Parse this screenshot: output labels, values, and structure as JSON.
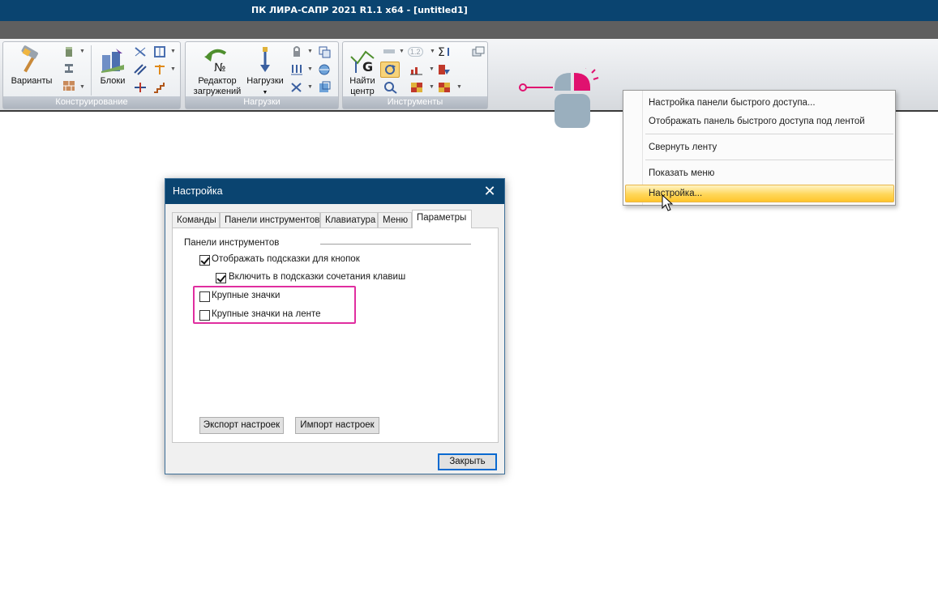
{
  "window": {
    "title": "ПК ЛИРА-САПР  2021 R1.1 x64 - [untitled1]"
  },
  "ribbon": {
    "groups": [
      {
        "label": "Конструирование",
        "buttons": [
          "Варианты",
          "Блоки"
        ]
      },
      {
        "label": "Нагрузки",
        "buttons": [
          "Редактор загружений",
          "Нагрузки"
        ]
      },
      {
        "label": "Инструменты",
        "buttons": [
          "Найти центр"
        ]
      }
    ],
    "btn_variants": "Варианты",
    "btn_blocks": "Блоки",
    "btn_load_editor_l1": "Редактор",
    "btn_load_editor_l2": "загружений",
    "btn_loads": "Нагрузки",
    "btn_find_center_l1": "Найти",
    "btn_find_center_l2": "центр",
    "small_label_12": "1.2"
  },
  "context_menu": {
    "items": [
      "Настройка панели быстрого доступа...",
      "Отображать панель быстрого доступа под лентой",
      "Свернуть ленту",
      "Показать меню",
      "Настройка..."
    ],
    "highlighted_index": 4
  },
  "dialog": {
    "title": "Настройка",
    "tabs": [
      "Команды",
      "Панели инструментов",
      "Клавиатура",
      "Меню",
      "Параметры"
    ],
    "active_tab": "Параметры",
    "section_title": "Панели инструментов",
    "options": [
      {
        "label": "Отображать подсказки для кнопок",
        "checked": true
      },
      {
        "label": "Включить в подсказки сочетания клавиш",
        "checked": true
      },
      {
        "label": "Крупные значки",
        "checked": false
      },
      {
        "label": "Крупные значки на ленте",
        "checked": false
      }
    ],
    "export_button": "Экспорт настроек",
    "import_button": "Импорт настроек",
    "close_button": "Закрыть"
  },
  "colors": {
    "titlebar": "#0a4470",
    "highlight_frame": "#e02ea0",
    "menu_highlight": "#ffd75a",
    "mouse_accent": "#e0116f"
  }
}
